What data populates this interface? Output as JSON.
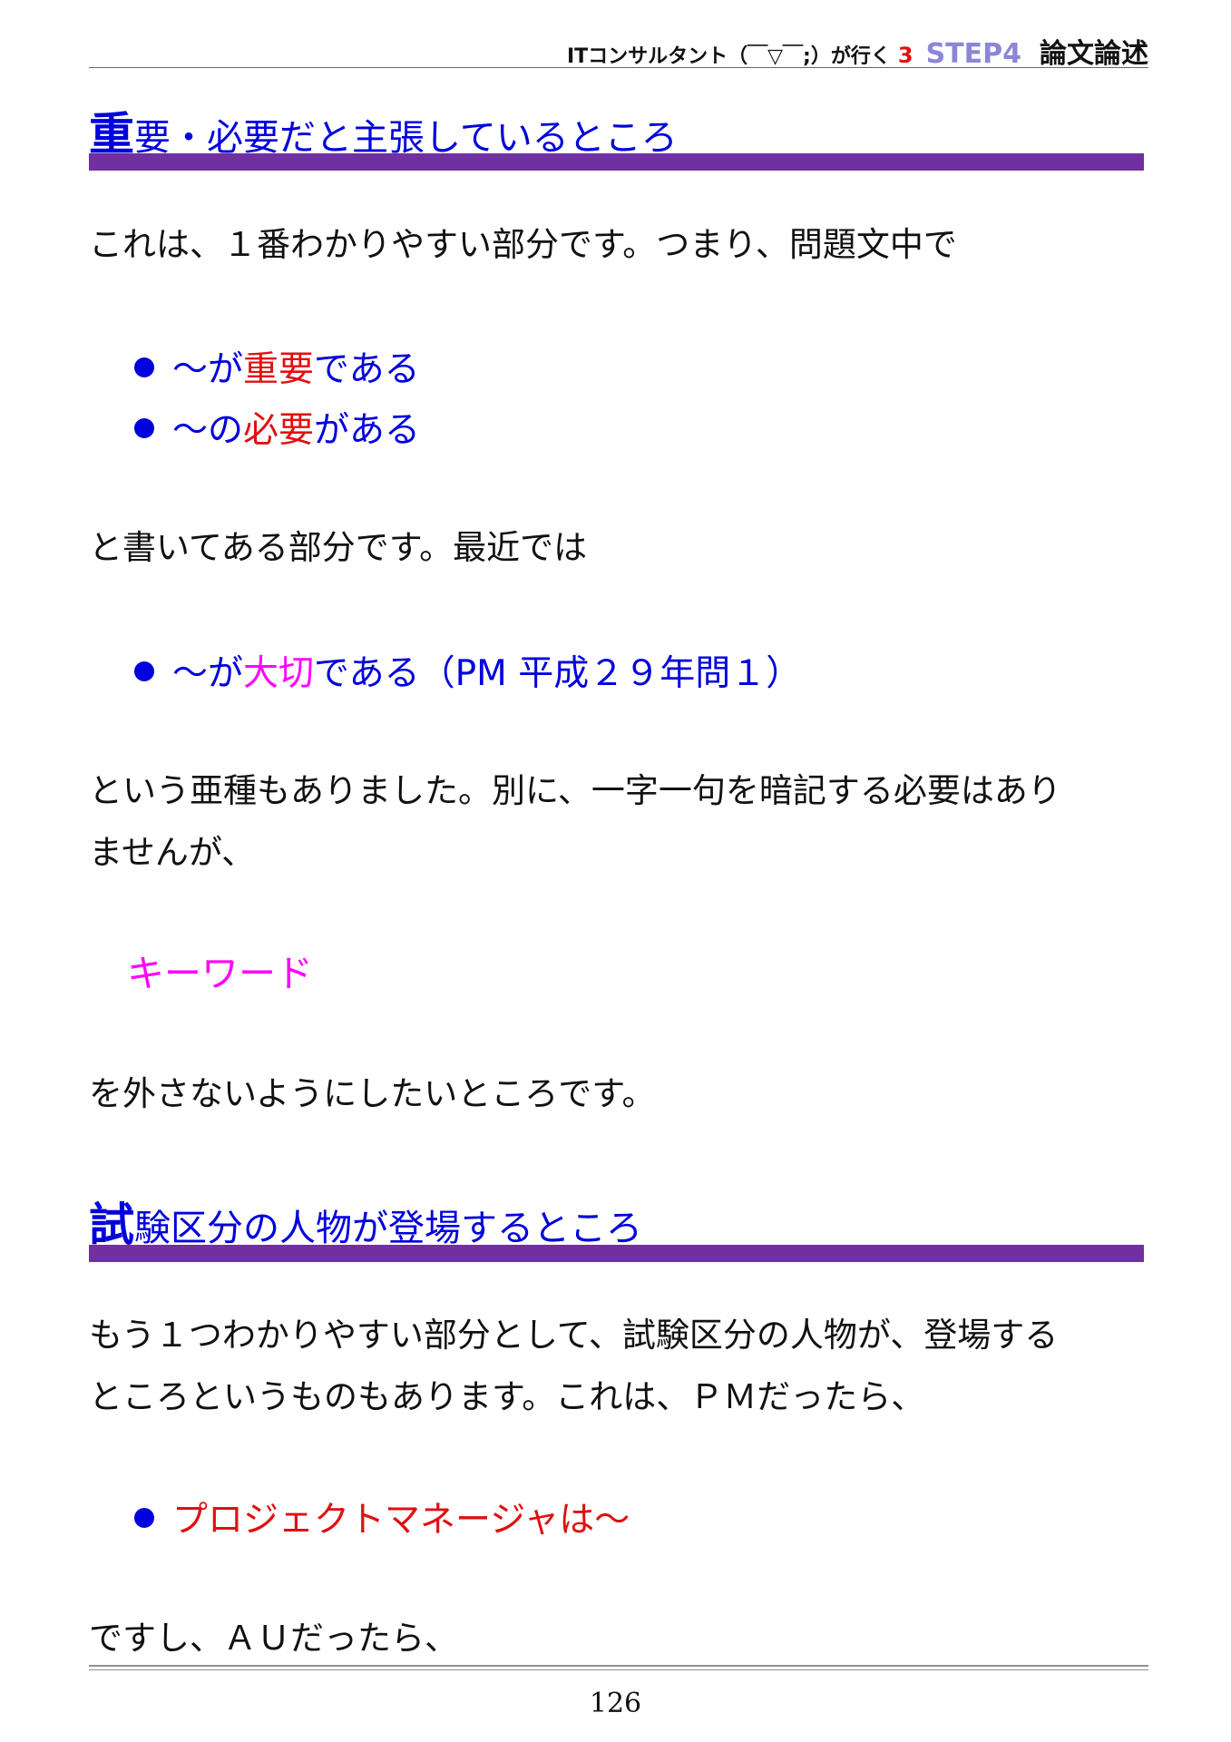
{
  "header": {
    "book_title": "ITコンサルタント（￣▽￣;）が行く",
    "volume": "3",
    "step": "STEP4",
    "chapter": "論文論述"
  },
  "section1": {
    "title_first": "重",
    "title_rest": "要・必要だと主張しているところ",
    "para1": "これは、１番わかりやすい部分です。つまり、問題文中で",
    "bullets": [
      {
        "prefix": "～が",
        "emphasis": "重要",
        "suffix": "である"
      },
      {
        "prefix": "～の",
        "emphasis": "必要",
        "suffix": "がある"
      }
    ],
    "para2": "と書いてある部分です。最近では",
    "bullet3": {
      "prefix": "～が",
      "emphasis": "大切",
      "suffix": "である（PM 平成２９年問１）"
    },
    "para3_line1": "という亜種もありました。別に、一字一句を暗記する必要はあり",
    "para3_line2": "ませんが、",
    "keyword": "キーワード",
    "para4": "を外さないようにしたいところです。"
  },
  "section2": {
    "title_first": "試",
    "title_rest": "験区分の人物が登場するところ",
    "para1_line1": "もう１つわかりやすい部分として、試験区分の人物が、登場する",
    "para1_line2": "ところというものもあります。これは、ＰＭだったら、",
    "bullet": "プロジェクトマネージャは～",
    "para2": "ですし、ＡＵだったら、"
  },
  "footer": {
    "page_number": "126"
  }
}
